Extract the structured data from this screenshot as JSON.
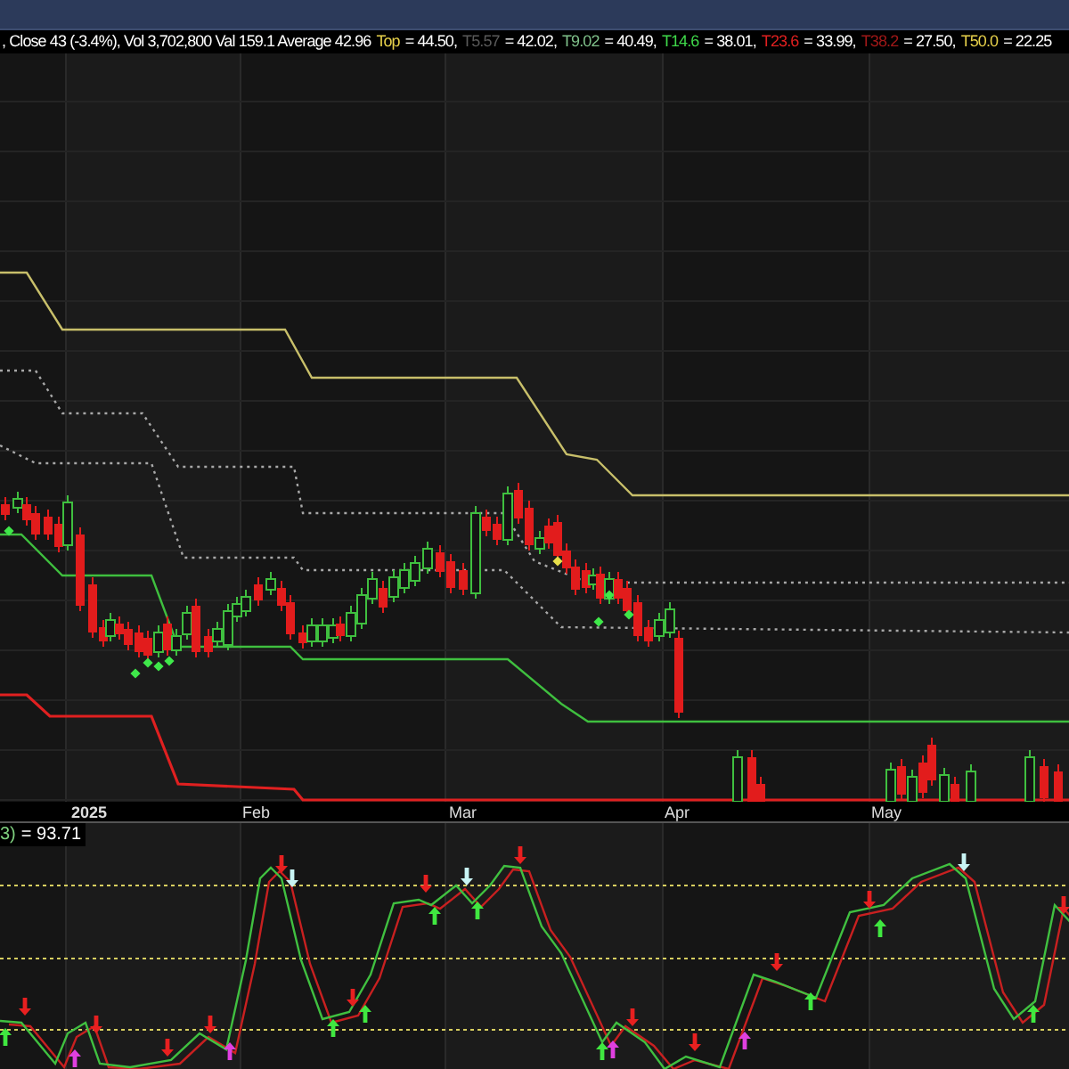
{
  "legend": {
    "summary": ", Close 43 (-3.4%), Vol 3,702,800 Val 159.1 Average 42.96",
    "levels": [
      {
        "label": "Top",
        "color": "#e6d04a",
        "value": "= 44.50,"
      },
      {
        "label": "T5.57",
        "color": "#5a5a5a",
        "value": "= 42.02,"
      },
      {
        "label": "T9.02",
        "color": "#7fc08a",
        "value": "= 40.49,"
      },
      {
        "label": "T14.6",
        "color": "#3fd84a",
        "value": "= 38.01,"
      },
      {
        "label": "T23.6",
        "color": "#e02020",
        "value": "= 33.99,"
      },
      {
        "label": "T38.2",
        "color": "#a01818",
        "value": "= 27.50,"
      },
      {
        "label": "T50.0",
        "color": "#e6d04a",
        "value": "= 22.25"
      }
    ]
  },
  "x_axis": {
    "labels": [
      {
        "text": "2025",
        "bold": true
      },
      {
        "text": "Feb",
        "bold": false
      },
      {
        "text": "Mar",
        "bold": false
      },
      {
        "text": "Apr",
        "bold": false
      },
      {
        "text": "May",
        "bold": false
      }
    ]
  },
  "oscillator": {
    "label": "3)",
    "value": "= 93.71"
  }
}
